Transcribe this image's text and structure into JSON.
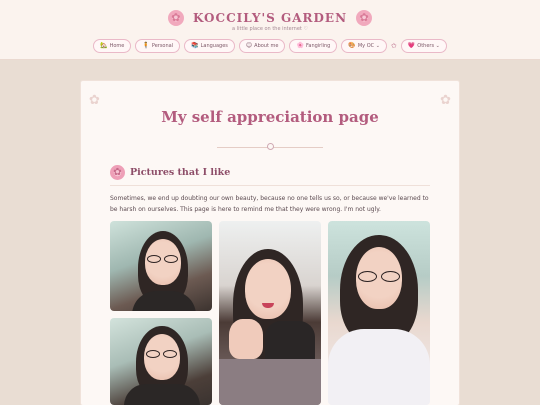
{
  "site": {
    "title": "KOCCILY'S GARDEN",
    "tagline": "a little place on the internet ♡"
  },
  "nav": {
    "items": [
      {
        "icon": "house-icon",
        "glyph": "🏡",
        "label": "Home"
      },
      {
        "icon": "person-icon",
        "glyph": "🧍",
        "label": "Personal"
      },
      {
        "icon": "books-icon",
        "glyph": "📚",
        "label": "Languages"
      },
      {
        "icon": "smiley-icon",
        "glyph": "😊",
        "label": "About me"
      },
      {
        "icon": "flower-icon",
        "glyph": "🌸",
        "label": "Fangirling"
      },
      {
        "icon": "palette-icon",
        "glyph": "🎨",
        "label": "My OC ⌄"
      },
      {
        "icon": "heart-icon",
        "glyph": "💗",
        "label": "Others ⌄"
      }
    ],
    "star": "✩"
  },
  "page": {
    "title": "My self appreciation page",
    "section_title": "Pictures that I like",
    "intro": "Sometimes, we end up doubting our own beauty, because no one tells us so, or because we've learned to be harsh on ourselves. This page is here to remind me that they were wrong. I'm not ugly."
  },
  "colors": {
    "accent": "#b35c7e",
    "background": "#e9ddd3",
    "card": "#fdf8f5",
    "nav_border": "#eab9c8"
  }
}
